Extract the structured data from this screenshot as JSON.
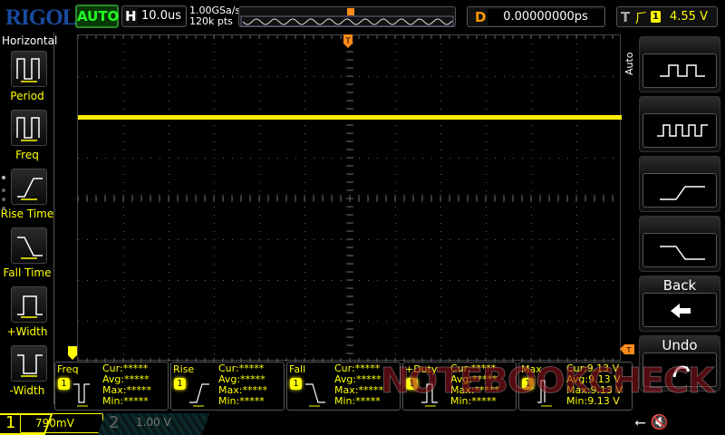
{
  "header": {
    "logo": "RIGOL",
    "run_mode": "AUTO",
    "timebase_key": "H",
    "timebase": "10.0us",
    "sample_rate": "1.00GSa/s",
    "memory_depth": "120k pts",
    "delay_key": "D",
    "delay": "0.00000000ps",
    "trigger_key": "T",
    "trigger_edge": "rising-edge-icon",
    "trigger_channel": "1",
    "trigger_level": "4.55 V"
  },
  "left_menu": {
    "title": "Horizontal",
    "items": [
      {
        "label": "Period"
      },
      {
        "label": "Freq"
      },
      {
        "label": "Rise Time"
      },
      {
        "label": "Fall Time"
      },
      {
        "label": "+Width"
      },
      {
        "label": "-Width"
      }
    ]
  },
  "right_menu": {
    "tab": "Auto",
    "items": [
      {
        "label": ""
      },
      {
        "label": ""
      },
      {
        "label": ""
      },
      {
        "label": ""
      },
      {
        "label": "Back"
      },
      {
        "label": "Undo"
      }
    ]
  },
  "measurements": [
    {
      "name": "Freq",
      "ch": "1",
      "cur": "Cur:*****",
      "avg": "Avg:*****",
      "max": "Max:*****",
      "min": "Min:*****"
    },
    {
      "name": "Rise",
      "ch": "1",
      "cur": "Cur:*****",
      "avg": "Avg:*****",
      "max": "Max:*****",
      "min": "Min:*****"
    },
    {
      "name": "Fall",
      "ch": "1",
      "cur": "Cur:*****",
      "avg": "Avg:*****",
      "max": "Max:*****",
      "min": "Min:*****"
    },
    {
      "name": "+Duty",
      "ch": "1",
      "cur": "Cur:*****",
      "avg": "Avg:*****",
      "max": "Max:*****",
      "min": "Min:*****"
    },
    {
      "name": "Max",
      "ch": "1",
      "cur": "Cur:9.13 V",
      "avg": "Avg:9.13 V",
      "max": "Max:9.13 V",
      "min": "Min:9.13 V"
    }
  ],
  "channels": [
    {
      "num": "1",
      "scale": "790mV",
      "color": "#ffff00"
    },
    {
      "num": "2",
      "scale": "1.00 V",
      "color": "#777777"
    }
  ],
  "watermark": "NOTEBOOKCHECK",
  "colors": {
    "ch1": "#ffff00",
    "trigger": "#ff8c1a",
    "auto": "#22ff22",
    "logo": "#1a4aa0"
  }
}
